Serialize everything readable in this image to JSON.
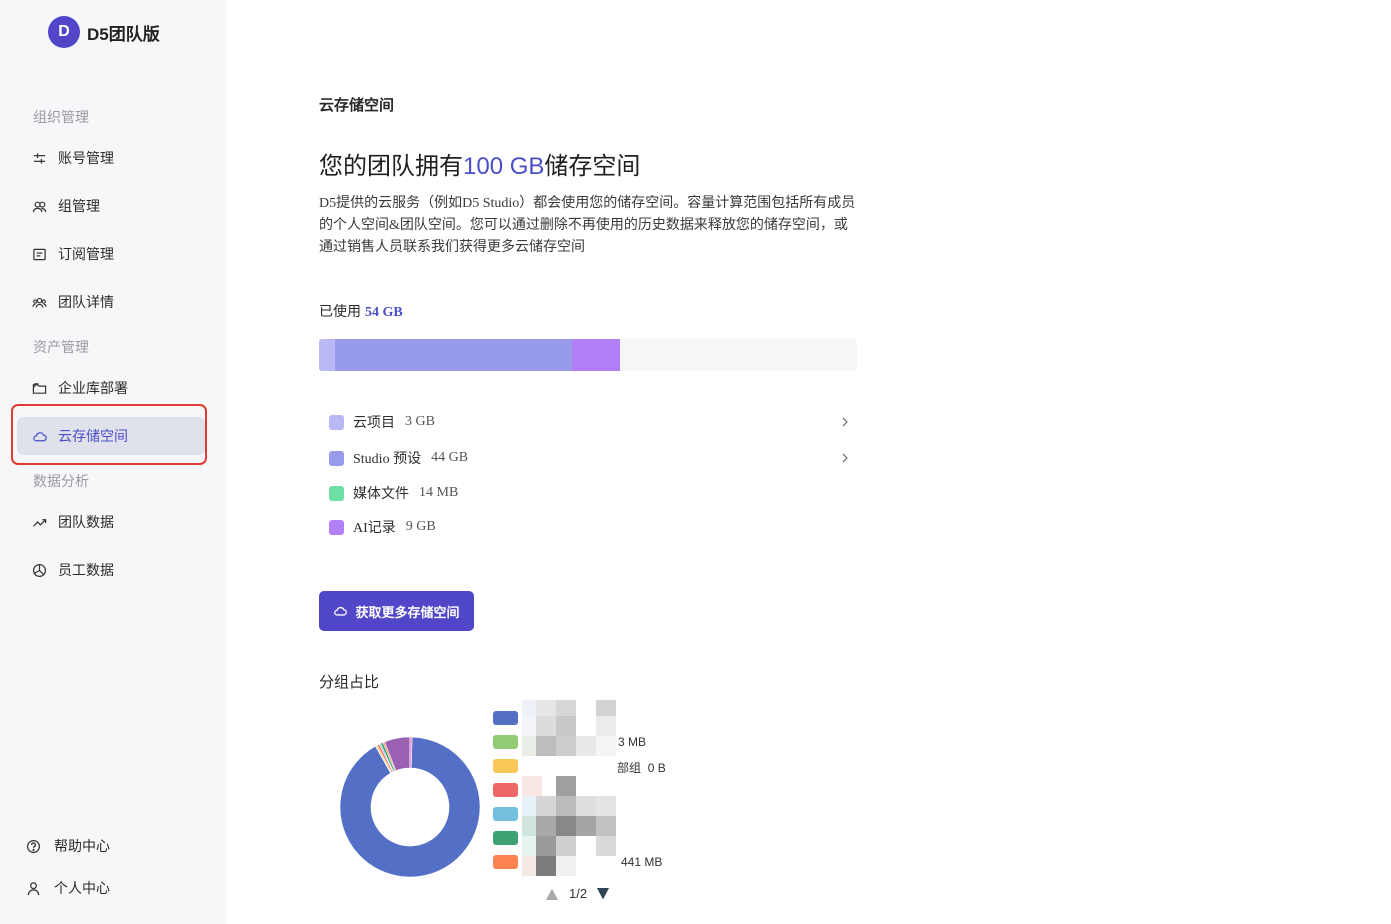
{
  "brand": {
    "avatar": "D",
    "name": "D5团队版"
  },
  "sidebar": {
    "sections": [
      {
        "label": "组织管理"
      },
      {
        "label": "资产管理"
      },
      {
        "label": "数据分析"
      }
    ],
    "items": [
      {
        "label": "账号管理",
        "icon": "sliders-icon"
      },
      {
        "label": "组管理",
        "icon": "group-icon"
      },
      {
        "label": "订阅管理",
        "icon": "subscription-icon"
      },
      {
        "label": "团队详情",
        "icon": "team-icon"
      },
      {
        "label": "企业库部署",
        "icon": "folder-icon"
      },
      {
        "label": "云存储空间",
        "icon": "cloud-icon",
        "active": true
      },
      {
        "label": "团队数据",
        "icon": "trend-icon"
      },
      {
        "label": "员工数据",
        "icon": "pie-icon"
      }
    ],
    "bottom": [
      {
        "label": "帮助中心",
        "icon": "help-icon"
      },
      {
        "label": "个人中心",
        "icon": "user-icon"
      }
    ]
  },
  "main": {
    "title": "云存储空间",
    "headline_prefix": "您的团队拥有",
    "headline_accent": "100 GB",
    "headline_suffix": "储存空间",
    "description": "D5提供的云服务（例如D5 Studio）都会使用您的储存空间。容量计算范围包括所有成员的个人空间&团队空间。您可以通过删除不再使用的历史数据来释放您的储存空间，或通过销售人员联系我们获得更多云储存空间",
    "used_label": "已使用",
    "used_value": "54 GB",
    "capacity_gb": 100,
    "categories": [
      {
        "name": "云项目",
        "size": "3 GB",
        "gb": 3,
        "color": "#b8b9f5",
        "expandable": true
      },
      {
        "name": "Studio 预设",
        "size": "44 GB",
        "gb": 44,
        "color": "#979bea",
        "expandable": true
      },
      {
        "name": "媒体文件",
        "size": "14 MB",
        "gb": 0.014,
        "color": "#6ee0a6",
        "expandable": false
      },
      {
        "name": "AI记录",
        "size": "9 GB",
        "gb": 9,
        "color": "#b180f7",
        "expandable": false
      }
    ],
    "cta_label": "获取更多存储空间",
    "group_title": "分组占比"
  },
  "chart_data": {
    "type": "pie",
    "title": "分组占比",
    "slice_colors": [
      "#5470c6",
      "#91cc75",
      "#fac858",
      "#ee6666",
      "#73c0de",
      "#3ba272",
      "#fc8452",
      "#9a60b4",
      "#ea7ccc"
    ],
    "values": [
      91.3,
      0.1,
      0.4,
      0.5,
      0.3,
      0.6,
      0.4,
      5.9,
      0.5
    ],
    "visible_text": [
      "3 MB",
      "0 B",
      "441 MB"
    ],
    "partial_label": "部组",
    "pager": "1/2"
  }
}
